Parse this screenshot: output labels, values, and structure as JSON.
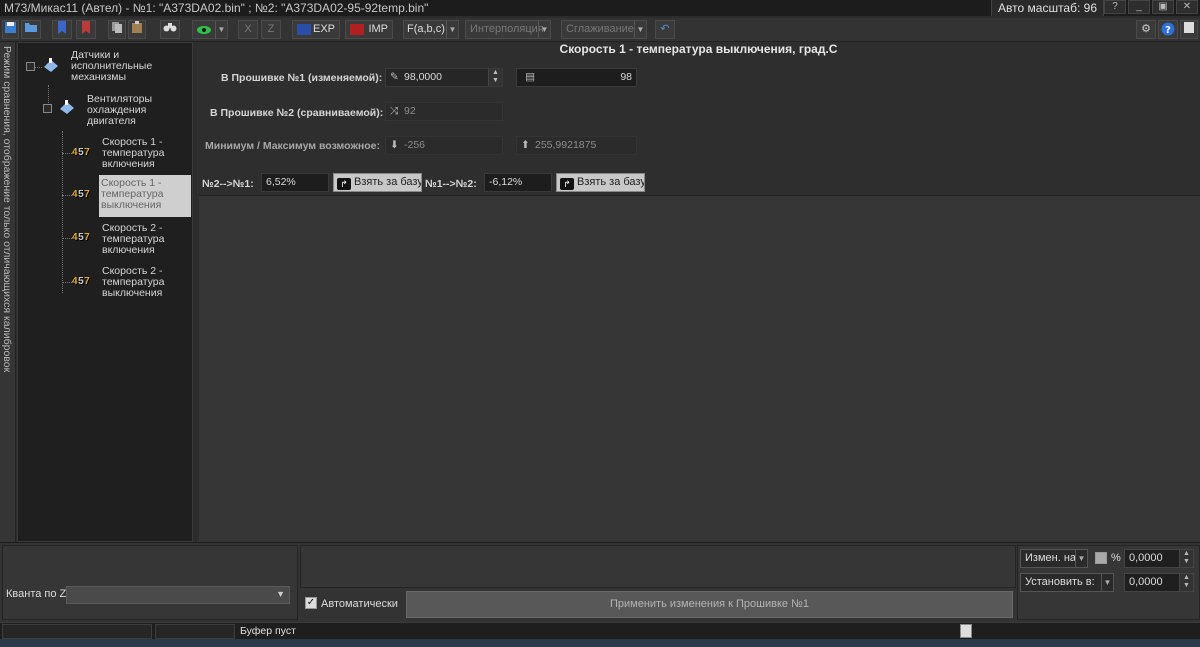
{
  "window": {
    "title": "M73/Микас11 (Автел) - №1: \"A373DA02.bin\" ; №2: \"A373DA02-95-92temp.bin\"",
    "autoscale": "Авто масштаб: 96",
    "controls": [
      "?",
      "_",
      "▣",
      "✕"
    ]
  },
  "toolbar": {
    "x_label": "X",
    "z_label": "Z",
    "exp_label": "EXP",
    "imp_label": "IMP",
    "formula_label": "F(a,b,c)",
    "interpolation_label": "Интерполяция",
    "smoothing_label": "Сглаживание"
  },
  "sidebar": {
    "vertical_text": "Режим сравнения, отображение только отличающихся калибровок"
  },
  "tree": {
    "root": "Датчики и исполнительные механизмы",
    "group": "Вентиляторы охлаждения двигателя",
    "items": [
      {
        "icon": "457",
        "label": "Скорость 1 - температура включения"
      },
      {
        "icon": "457",
        "label": "Скорость 1 - температура выключения"
      },
      {
        "icon": "457",
        "label": "Скорость 2 - температура включения"
      },
      {
        "icon": "457",
        "label": "Скорость 2 - температура выключения"
      }
    ]
  },
  "main": {
    "title": "Скорость 1 - температура выключения, град.С",
    "fw1_label": "В Прошивке №1 (изменяемой):",
    "fw1_value": "98,0000",
    "fw1_raw": "98",
    "fw2_label": "В Прошивке №2 (сравниваемой):",
    "fw2_value": "92",
    "minmax_label": "Минимум / Максимум возможное:",
    "min_value": "-256",
    "max_value": "255,9921875",
    "diff21_label": "№2-->№1:",
    "diff21_value": "6,52%",
    "diff12_label": "№1-->№2:",
    "diff12_value": "-6,12%",
    "take_base_label": "Взять за базу"
  },
  "bottom": {
    "quanta_label": "Кванта по Z:",
    "auto_label": "Автоматически",
    "apply_label": "Применить изменения к Прошивке №1",
    "change_by_label": "Измен. на",
    "percent_label": "%",
    "change_value": "0,0000",
    "set_to_label": "Установить в:",
    "set_value": "0,0000"
  },
  "status": {
    "text": "Буфер пуст"
  }
}
